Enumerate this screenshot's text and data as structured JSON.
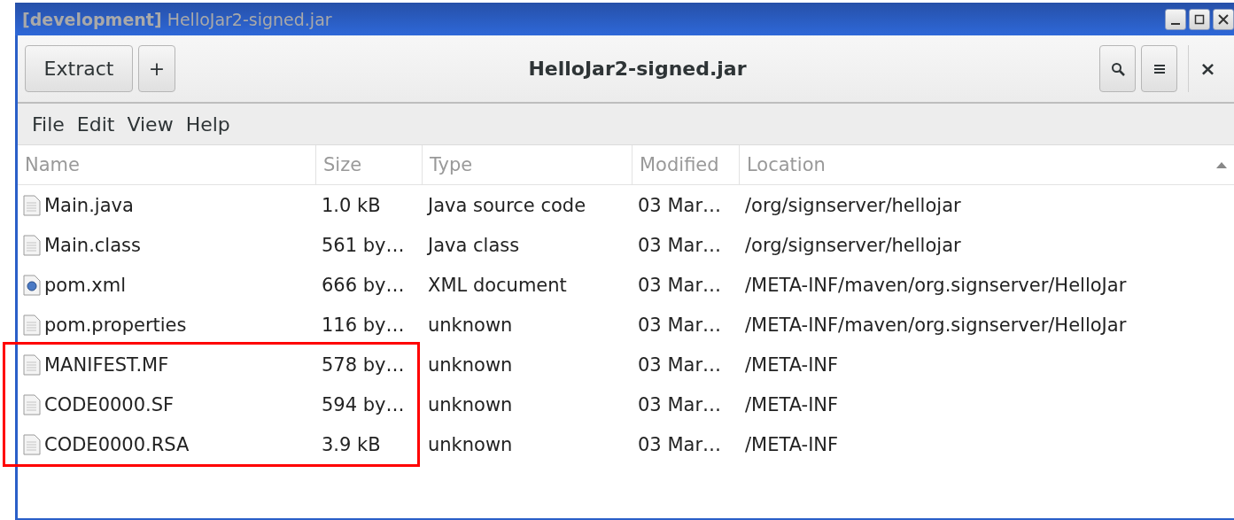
{
  "window": {
    "title": "**[development]** HelloJar2-signed.jar"
  },
  "toolbar": {
    "buttons": [
      "Extract",
      "+"
    ],
    "title": "HelloJar2-signed.jar",
    "close": "×"
  },
  "menu": [
    "File",
    "Edit",
    "View",
    "Help"
  ],
  "table": {
    "columns": [
      "Name",
      "Size",
      "Type",
      "Modified",
      "Location"
    ],
    "sort_ascending": true,
    "rows": [
      {
        "kind": "text",
        "name": "Main.java",
        "size": "1.0 kB",
        "type": "Java source code",
        "modified": "03 Mar…",
        "location": "/org/signserver/hellojar",
        "highlighted": false
      },
      {
        "kind": "text",
        "name": "Main.class",
        "size": "561 by…",
        "type": "Java class",
        "modified": "03 Mar…",
        "location": "/org/signserver/hellojar",
        "highlighted": false
      },
      {
        "kind": "xml",
        "name": "pom.xml",
        "size": "666 by…",
        "type": "XML document",
        "modified": "03 Mar…",
        "location": "/META-INF/maven/org.signserver/HelloJar",
        "highlighted": false
      },
      {
        "kind": "text",
        "name": "pom.properties",
        "size": "116 by…",
        "type": "unknown",
        "modified": "03 Mar…",
        "location": "/META-INF/maven/org.signserver/HelloJar",
        "highlighted": false
      },
      {
        "kind": "text",
        "name": "MANIFEST.MF",
        "size": "578 by…",
        "type": "unknown",
        "modified": "03 Mar…",
        "location": "/META-INF",
        "highlighted": true
      },
      {
        "kind": "text",
        "name": "CODE0000.SF",
        "size": "594 by…",
        "type": "unknown",
        "modified": "03 Mar…",
        "location": "/META-INF",
        "highlighted": true
      },
      {
        "kind": "text",
        "name": "CODE0000.RSA",
        "size": "3.9 kB",
        "type": "unknown",
        "modified": "03 Mar…",
        "location": "/META-INF",
        "highlighted": true
      }
    ]
  }
}
